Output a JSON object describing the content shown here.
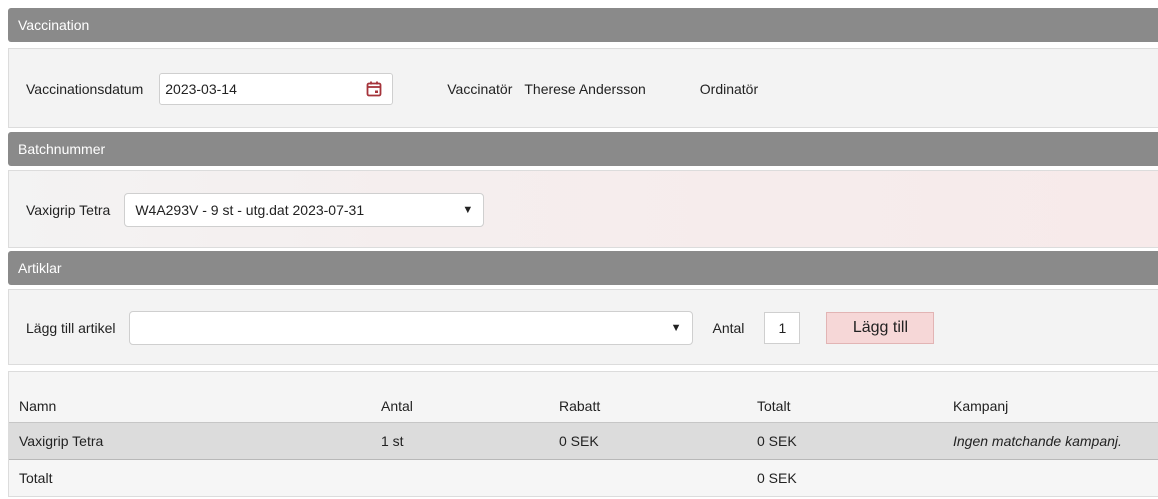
{
  "vaccination": {
    "header": "Vaccination",
    "date_label": "Vaccinationsdatum",
    "date_value": "2023-03-14",
    "vaccinator_label": "Vaccinatör",
    "vaccinator_value": "Therese Andersson",
    "ordinator_label": "Ordinatör"
  },
  "batch": {
    "header": "Batchnummer",
    "product_label": "Vaxigrip Tetra",
    "selected": "W4A293V - 9 st - utg.dat 2023-07-31"
  },
  "articles": {
    "header": "Artiklar",
    "add_label": "Lägg till artikel",
    "article_select_value": "",
    "qty_label": "Antal",
    "qty_value": "1",
    "add_button": "Lägg till",
    "table": {
      "columns": [
        "Namn",
        "Antal",
        "Rabatt",
        "Totalt",
        "Kampanj"
      ],
      "rows": [
        [
          "Vaxigrip Tetra",
          "1 st",
          "0 SEK",
          "0 SEK",
          "Ingen matchande kampanj."
        ]
      ],
      "total_label": "Totalt",
      "total_value": "0 SEK"
    }
  },
  "colors": {
    "header_bg": "#8a8a8a",
    "panel_bg": "#f3f3f3",
    "accent": "#a5333a",
    "button_bg": "#f6d7d7"
  },
  "icons": {
    "date_picker": "calendar-icon",
    "dropdown": "caret-down-icon"
  }
}
